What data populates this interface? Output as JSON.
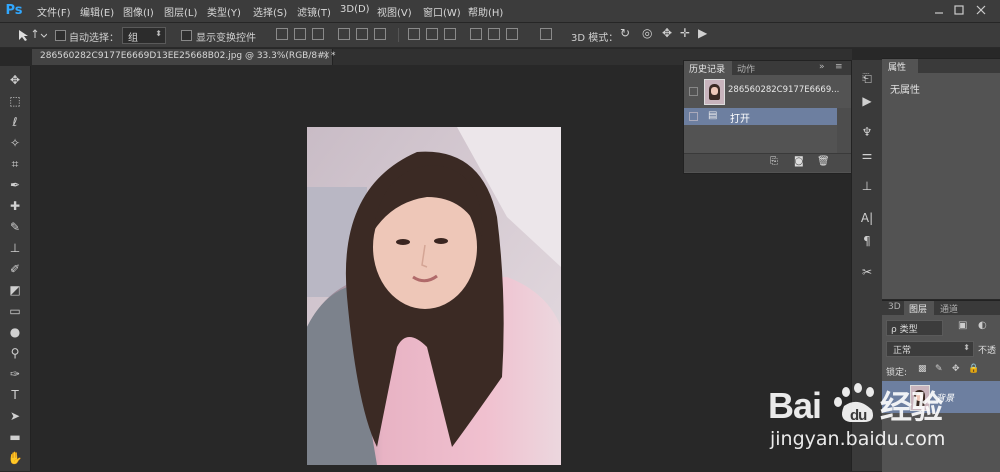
{
  "app": {
    "logo": "Ps"
  },
  "menu": [
    "文件(F)",
    "编辑(E)",
    "图像(I)",
    "图层(L)",
    "类型(Y)",
    "选择(S)",
    "滤镜(T)",
    "3D(D)",
    "视图(V)",
    "窗口(W)",
    "帮助(H)"
  ],
  "options_bar": {
    "auto_select_label": "自动选择：",
    "auto_select_value": "组",
    "show_transform_label": "显示变换控件",
    "mode_3d_label": "3D 模式："
  },
  "document": {
    "tab_label": "286560282C9177E6669D13EE25668B02.jpg @ 33.3%(RGB/8#) *",
    "close": "×"
  },
  "history_panel": {
    "tab_history": "历史记录",
    "tab_actions": "动作",
    "snapshot_name": "286560282C9177E6669...",
    "step_open": "打开"
  },
  "properties_panel": {
    "tab": "属性",
    "empty_text": "无属性"
  },
  "layers_panel": {
    "tab_3d": "3D",
    "tab_layers": "图层",
    "tab_channels": "通道",
    "filter_label": "ρ 类型",
    "blend_mode": "正常",
    "opacity_label": "不透",
    "lock_label": "锁定:",
    "layer_name": "背景"
  },
  "watermark": {
    "logo": "Bai du 经验",
    "url": "jingyan.baidu.com"
  },
  "colors": {
    "accent_blue": "#31a8ff",
    "selection": "#6d7fa0",
    "panel": "#535353",
    "chrome": "#3c3c3c"
  }
}
